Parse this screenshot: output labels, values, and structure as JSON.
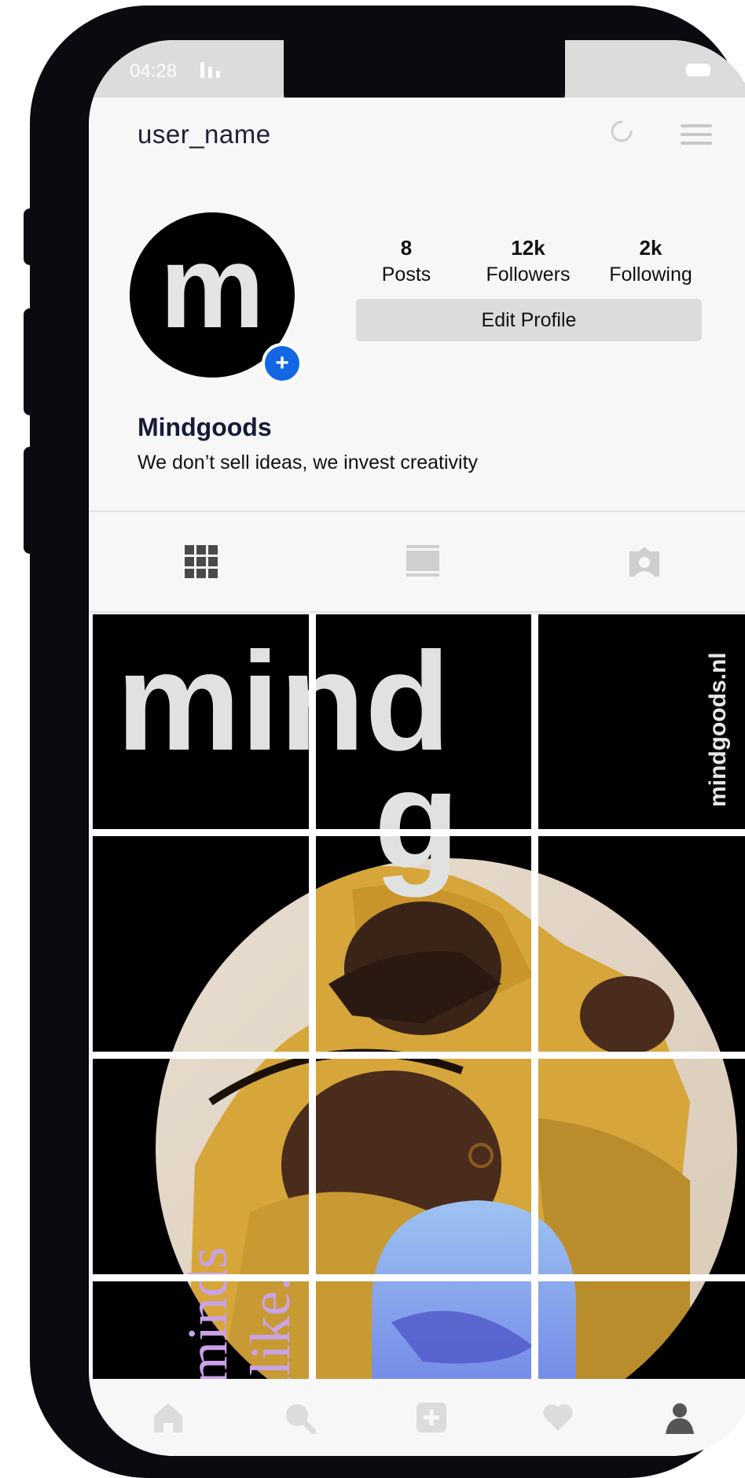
{
  "status": {
    "time": "04:28"
  },
  "header": {
    "username": "user_name"
  },
  "profile": {
    "avatar_letter": "m",
    "display_name": "Mindgoods",
    "bio": "We don’t sell ideas, we invest creativity",
    "stats": [
      {
        "value": "8",
        "label": "Posts"
      },
      {
        "value": "12k",
        "label": "Followers"
      },
      {
        "value": "2k",
        "label": "Following"
      }
    ],
    "edit_label": "Edit Profile"
  },
  "tabs": [
    "grid-icon",
    "feed-icon",
    "tagged-icon"
  ],
  "grid_art": {
    "big_word_top": "mind",
    "big_letter": "g",
    "site": "mindgoods.nl",
    "script_1": "minds",
    "script_2": "alike."
  },
  "bottom_nav": [
    "home-icon",
    "search-icon",
    "add-post-icon",
    "heart-icon",
    "profile-icon"
  ],
  "colors": {
    "accent": "#1367e5",
    "script_text": "#c9a2e8",
    "art_text": "#e4e4e4"
  }
}
